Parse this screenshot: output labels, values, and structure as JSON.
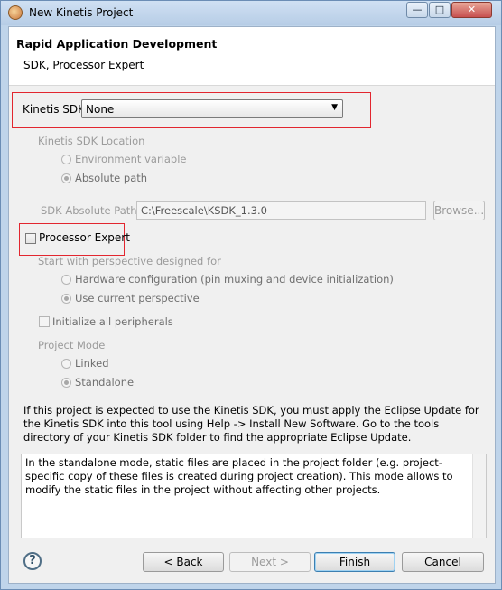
{
  "window": {
    "title": "New Kinetis Project",
    "controls": {
      "minimize": "—",
      "maximize": "□",
      "close": "✕"
    }
  },
  "header": {
    "title": "Rapid Application Development",
    "subtitle": "SDK, Processor Expert"
  },
  "sdk": {
    "label": "Kinetis SDK",
    "selected": "None"
  },
  "location": {
    "group_label": "Kinetis SDK Location",
    "options": [
      {
        "label": "Environment variable",
        "checked": false
      },
      {
        "label": "Absolute path",
        "checked": true
      }
    ]
  },
  "path": {
    "label": "SDK Absolute Path",
    "value": "C:\\Freescale\\KSDK_1.3.0",
    "browse_label": "Browse..."
  },
  "pe": {
    "label": "Processor Expert",
    "checked": false
  },
  "perspective": {
    "group_label": "Start with perspective designed for",
    "options": [
      {
        "label": "Hardware configuration (pin muxing and device initialization)",
        "checked": false
      },
      {
        "label": "Use current perspective",
        "checked": true
      }
    ]
  },
  "init": {
    "label": "Initialize all peripherals",
    "checked": false
  },
  "mode": {
    "group_label": "Project Mode",
    "options": [
      {
        "label": "Linked",
        "checked": false
      },
      {
        "label": "Standalone",
        "checked": true
      }
    ]
  },
  "info": {
    "text": "If this project is expected to use the Kinetis SDK, you must apply the Eclipse Update for the Kinetis SDK into this tool using Help -> Install New Software. Go to the tools directory of your Kinetis SDK folder to find the appropriate Eclipse Update."
  },
  "description": {
    "text": "In the standalone mode, static files are placed in the project folder (e.g.  project-specific copy of these files is created during project creation). This mode allows to modify the static files in the project without affecting other projects."
  },
  "buttons": {
    "help": "?",
    "back": "< Back",
    "next": "Next >",
    "finish": "Finish",
    "cancel": "Cancel"
  }
}
